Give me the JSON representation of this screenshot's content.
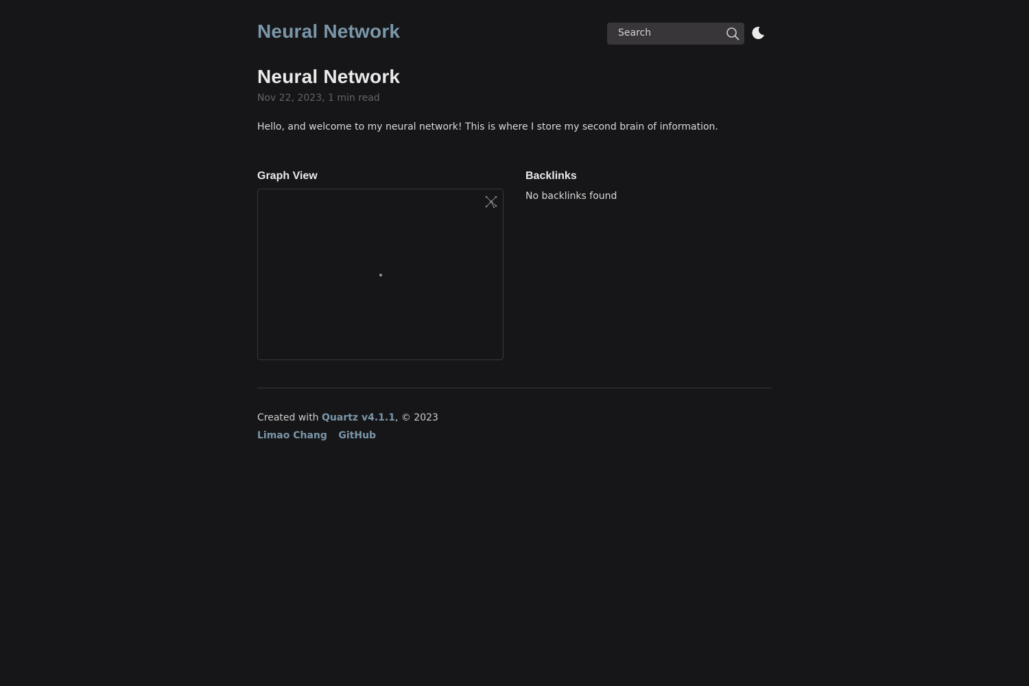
{
  "header": {
    "site_title": "Neural Network",
    "search_label": "Search",
    "theme_icon": "moon-icon"
  },
  "article": {
    "title": "Neural Network",
    "meta": "Nov 22, 2023, 1 min read",
    "body": "Hello, and welcome to my neural network! This is where I store my second brain of information."
  },
  "graph": {
    "heading": "Graph View",
    "icon": "global-graph-icon",
    "node_color": "#8a9aa8"
  },
  "backlinks": {
    "heading": "Backlinks",
    "empty_text": "No backlinks found"
  },
  "footer": {
    "created_prefix": "Created with ",
    "quartz_link": "Quartz v4.1.1",
    "copyright": ", © 2023",
    "links": [
      "Limao Chang",
      "GitHub"
    ]
  },
  "colors": {
    "background": "#161618",
    "accent": "#7b97aa",
    "text": "#ebebec",
    "muted": "#646464",
    "search_bg": "#393639"
  }
}
